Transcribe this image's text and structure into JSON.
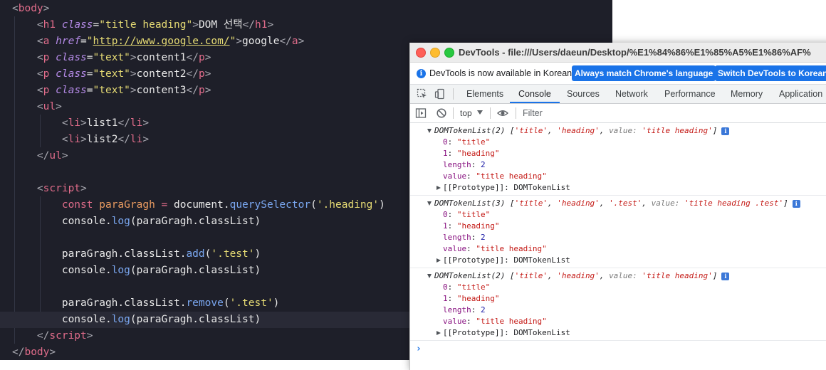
{
  "editor": {
    "lines": [
      {
        "tokens": [
          [
            "br",
            "<"
          ],
          [
            "tag",
            "body"
          ],
          [
            "br",
            ">"
          ]
        ]
      },
      {
        "tokens": [
          [
            "pn",
            "    "
          ],
          [
            "br",
            "<"
          ],
          [
            "tag",
            "h1"
          ],
          [
            "pn",
            " "
          ],
          [
            "attr",
            "class"
          ],
          [
            "pn",
            "="
          ],
          [
            "str",
            "\"title heading\""
          ],
          [
            "br",
            ">"
          ],
          [
            "pn",
            "DOM 선택"
          ],
          [
            "br",
            "</"
          ],
          [
            "tag",
            "h1"
          ],
          [
            "br",
            ">"
          ]
        ]
      },
      {
        "tokens": [
          [
            "pn",
            "    "
          ],
          [
            "br",
            "<"
          ],
          [
            "tag",
            "a"
          ],
          [
            "pn",
            " "
          ],
          [
            "attr",
            "href"
          ],
          [
            "pn",
            "="
          ],
          [
            "str",
            "\""
          ],
          [
            "url",
            "http://www.google.com/"
          ],
          [
            "str",
            "\""
          ],
          [
            "br",
            ">"
          ],
          [
            "pn",
            "google"
          ],
          [
            "br",
            "</"
          ],
          [
            "tag",
            "a"
          ],
          [
            "br",
            ">"
          ]
        ]
      },
      {
        "tokens": [
          [
            "pn",
            "    "
          ],
          [
            "br",
            "<"
          ],
          [
            "tag",
            "p"
          ],
          [
            "pn",
            " "
          ],
          [
            "attr",
            "class"
          ],
          [
            "pn",
            "="
          ],
          [
            "str",
            "\"text\""
          ],
          [
            "br",
            ">"
          ],
          [
            "pn",
            "content1"
          ],
          [
            "br",
            "</"
          ],
          [
            "tag",
            "p"
          ],
          [
            "br",
            ">"
          ]
        ]
      },
      {
        "tokens": [
          [
            "pn",
            "    "
          ],
          [
            "br",
            "<"
          ],
          [
            "tag",
            "p"
          ],
          [
            "pn",
            " "
          ],
          [
            "attr",
            "class"
          ],
          [
            "pn",
            "="
          ],
          [
            "str",
            "\"text\""
          ],
          [
            "br",
            ">"
          ],
          [
            "pn",
            "content2"
          ],
          [
            "br",
            "</"
          ],
          [
            "tag",
            "p"
          ],
          [
            "br",
            ">"
          ]
        ]
      },
      {
        "tokens": [
          [
            "pn",
            "    "
          ],
          [
            "br",
            "<"
          ],
          [
            "tag",
            "p"
          ],
          [
            "pn",
            " "
          ],
          [
            "attr",
            "class"
          ],
          [
            "pn",
            "="
          ],
          [
            "str",
            "\"text\""
          ],
          [
            "br",
            ">"
          ],
          [
            "pn",
            "content3"
          ],
          [
            "br",
            "</"
          ],
          [
            "tag",
            "p"
          ],
          [
            "br",
            ">"
          ]
        ]
      },
      {
        "tokens": [
          [
            "pn",
            "    "
          ],
          [
            "br",
            "<"
          ],
          [
            "tag",
            "ul"
          ],
          [
            "br",
            ">"
          ]
        ]
      },
      {
        "tokens": [
          [
            "pn",
            "        "
          ],
          [
            "br",
            "<"
          ],
          [
            "tag",
            "li"
          ],
          [
            "br",
            ">"
          ],
          [
            "pn",
            "list1"
          ],
          [
            "br",
            "</"
          ],
          [
            "tag",
            "li"
          ],
          [
            "br",
            ">"
          ]
        ]
      },
      {
        "tokens": [
          [
            "pn",
            "        "
          ],
          [
            "br",
            "<"
          ],
          [
            "tag",
            "li"
          ],
          [
            "br",
            ">"
          ],
          [
            "pn",
            "list2"
          ],
          [
            "br",
            "</"
          ],
          [
            "tag",
            "li"
          ],
          [
            "br",
            ">"
          ]
        ]
      },
      {
        "tokens": [
          [
            "pn",
            "    "
          ],
          [
            "br",
            "</"
          ],
          [
            "tag",
            "ul"
          ],
          [
            "br",
            ">"
          ]
        ]
      },
      {
        "tokens": []
      },
      {
        "tokens": [
          [
            "pn",
            "    "
          ],
          [
            "br",
            "<"
          ],
          [
            "tag",
            "script"
          ],
          [
            "br",
            ">"
          ]
        ]
      },
      {
        "tokens": [
          [
            "pn",
            "        "
          ],
          [
            "kw",
            "const"
          ],
          [
            "pn",
            " "
          ],
          [
            "var",
            "paraGragh"
          ],
          [
            "pn",
            " "
          ],
          [
            "kw",
            "="
          ],
          [
            "pn",
            " document."
          ],
          [
            "fn",
            "querySelector"
          ],
          [
            "pn",
            "("
          ],
          [
            "str",
            "'.heading'"
          ],
          [
            "pn",
            ")"
          ]
        ]
      },
      {
        "tokens": [
          [
            "pn",
            "        console."
          ],
          [
            "fn",
            "log"
          ],
          [
            "pn",
            "(paraGragh.classList)"
          ]
        ]
      },
      {
        "tokens": []
      },
      {
        "tokens": [
          [
            "pn",
            "        paraGragh.classList."
          ],
          [
            "fn",
            "add"
          ],
          [
            "pn",
            "("
          ],
          [
            "str",
            "'.test'"
          ],
          [
            "pn",
            ")"
          ]
        ]
      },
      {
        "tokens": [
          [
            "pn",
            "        console."
          ],
          [
            "fn",
            "log"
          ],
          [
            "pn",
            "(paraGragh.classList)"
          ]
        ]
      },
      {
        "tokens": []
      },
      {
        "tokens": [
          [
            "pn",
            "        paraGragh.classList."
          ],
          [
            "fn",
            "remove"
          ],
          [
            "pn",
            "("
          ],
          [
            "str",
            "'.test'"
          ],
          [
            "pn",
            ")"
          ]
        ]
      },
      {
        "tokens": [
          [
            "pn",
            "        console."
          ],
          [
            "fn",
            "log"
          ],
          [
            "pn",
            "(paraGragh.classList)"
          ]
        ],
        "current": true
      },
      {
        "tokens": [
          [
            "pn",
            "    "
          ],
          [
            "br",
            "</"
          ],
          [
            "tag",
            "script"
          ],
          [
            "br",
            ">"
          ]
        ]
      },
      {
        "tokens": [
          [
            "br",
            "</"
          ],
          [
            "tag",
            "body"
          ],
          [
            "br",
            ">"
          ]
        ]
      }
    ]
  },
  "devtools": {
    "window_title": "DevTools - file:///Users/daeun/Desktop/%E1%84%86%E1%85%A5%E1%86%AF%",
    "infobar": {
      "message": "DevTools is now available in Korean!",
      "match_button": "Always match Chrome's language",
      "switch_button": "Switch DevTools to Korean"
    },
    "tabs": [
      "Elements",
      "Console",
      "Sources",
      "Network",
      "Performance",
      "Memory",
      "Application"
    ],
    "active_tab": "Console",
    "toolbar": {
      "context": "top",
      "filter_placeholder": "Filter"
    },
    "entries": [
      {
        "summary": [
          [
            "sum",
            "DOMTokenList(2) ["
          ],
          [
            "cs",
            "'title'"
          ],
          [
            "sum",
            ", "
          ],
          [
            "cs",
            "'heading'"
          ],
          [
            "sum",
            ", "
          ],
          [
            "ck",
            "value: "
          ],
          [
            "cs",
            "'title heading'"
          ],
          [
            "sum",
            "]"
          ]
        ],
        "props": [
          [
            [
              "pk",
              "0"
            ],
            [
              "pt",
              ": "
            ],
            [
              "pv",
              "\"title\""
            ]
          ],
          [
            [
              "pk",
              "1"
            ],
            [
              "pt",
              ": "
            ],
            [
              "pv",
              "\"heading\""
            ]
          ],
          [
            [
              "pk",
              "length"
            ],
            [
              "pt",
              ": "
            ],
            [
              "pn2",
              "2"
            ]
          ],
          [
            [
              "pk",
              "value"
            ],
            [
              "pt",
              ": "
            ],
            [
              "pv",
              "\"title heading\""
            ]
          ]
        ],
        "proto": "[[Prototype]]: DOMTokenList"
      },
      {
        "summary": [
          [
            "sum",
            "DOMTokenList(3) ["
          ],
          [
            "cs",
            "'title'"
          ],
          [
            "sum",
            ", "
          ],
          [
            "cs",
            "'heading'"
          ],
          [
            "sum",
            ", "
          ],
          [
            "cs",
            "'.test'"
          ],
          [
            "sum",
            ", "
          ],
          [
            "ck",
            "value: "
          ],
          [
            "cs",
            "'title heading .test'"
          ],
          [
            "sum",
            "]"
          ]
        ],
        "props": [
          [
            [
              "pk",
              "0"
            ],
            [
              "pt",
              ": "
            ],
            [
              "pv",
              "\"title\""
            ]
          ],
          [
            [
              "pk",
              "1"
            ],
            [
              "pt",
              ": "
            ],
            [
              "pv",
              "\"heading\""
            ]
          ],
          [
            [
              "pk",
              "length"
            ],
            [
              "pt",
              ": "
            ],
            [
              "pn2",
              "2"
            ]
          ],
          [
            [
              "pk",
              "value"
            ],
            [
              "pt",
              ": "
            ],
            [
              "pv",
              "\"title heading\""
            ]
          ]
        ],
        "proto": "[[Prototype]]: DOMTokenList"
      },
      {
        "summary": [
          [
            "sum",
            "DOMTokenList(2) ["
          ],
          [
            "cs",
            "'title'"
          ],
          [
            "sum",
            ", "
          ],
          [
            "cs",
            "'heading'"
          ],
          [
            "sum",
            ", "
          ],
          [
            "ck",
            "value: "
          ],
          [
            "cs",
            "'title heading'"
          ],
          [
            "sum",
            "]"
          ]
        ],
        "props": [
          [
            [
              "pk",
              "0"
            ],
            [
              "pt",
              ": "
            ],
            [
              "pv",
              "\"title\""
            ]
          ],
          [
            [
              "pk",
              "1"
            ],
            [
              "pt",
              ": "
            ],
            [
              "pv",
              "\"heading\""
            ]
          ],
          [
            [
              "pk",
              "length"
            ],
            [
              "pt",
              ": "
            ],
            [
              "pn2",
              "2"
            ]
          ],
          [
            [
              "pk",
              "value"
            ],
            [
              "pt",
              ": "
            ],
            [
              "pv",
              "\"title heading\""
            ]
          ]
        ],
        "proto": "[[Prototype]]: DOMTokenList"
      }
    ],
    "prompt": "›"
  }
}
